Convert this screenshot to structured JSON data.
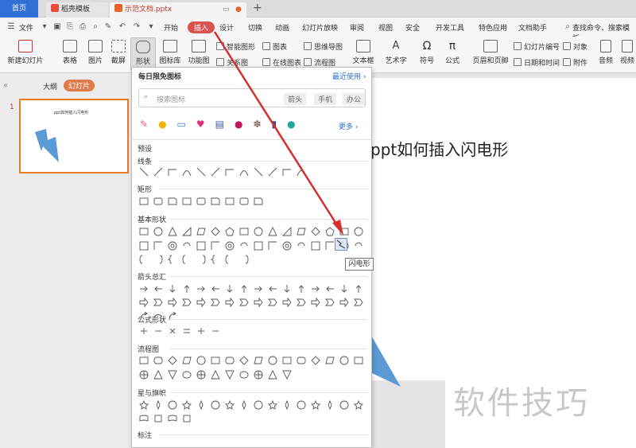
{
  "tabs": [
    {
      "label": "首页"
    },
    {
      "label": "稻壳模板"
    },
    {
      "label": "示范文档.pptx"
    }
  ],
  "menu": {
    "file": "文件",
    "items": [
      "开始",
      "插入",
      "设计",
      "切换",
      "动画",
      "幻灯片放映",
      "审阅",
      "视图",
      "安全",
      "开发工具",
      "特色应用",
      "文档助手"
    ],
    "active": "插入",
    "search": "查找命令、搜索模板"
  },
  "ribbon": {
    "new_slide": "新建幻灯片",
    "table": "表格",
    "picture": "图片",
    "screenshot": "截屏",
    "shape": "形状",
    "icon_library": "图标库",
    "function_chart": "功能图",
    "smart_graphic": "智能图形",
    "chart": "图表",
    "mind_map": "思维导图",
    "relation": "关系图",
    "online_chart": "在线图表",
    "flowchart": "流程图",
    "textbox": "文本框",
    "art_text": "艺术字",
    "symbol": "符号",
    "formula": "公式",
    "header_footer": "页眉和页脚",
    "slide_number": "幻灯片编号",
    "datetime": "日期和时间",
    "object": "对象",
    "attachment": "附件",
    "audio": "音频",
    "video": "视频"
  },
  "left_panel": {
    "outline_tab": "大纲",
    "slides_tab": "幻灯片",
    "slide_number": "1",
    "thumb_title": "ppt如何插入闪电形"
  },
  "slide": {
    "title": "ppt如何插入闪电形"
  },
  "dropdown": {
    "header": "每日限免图标",
    "recent": "最近使用",
    "search_placeholder": "搜索图标",
    "tags": [
      "箭头",
      "手机",
      "办公"
    ],
    "more": "更多",
    "preset": "预设",
    "sections": [
      "线条",
      "矩形",
      "基本形状",
      "箭头总汇",
      "公式形状",
      "流程图",
      "星与旗帜",
      "标注"
    ]
  },
  "tooltip": "闪电形",
  "watermark": "软件技巧",
  "colors": {
    "accent_red": "#d9534f",
    "home_tab": "#2f6fd6",
    "lightning_blue": "#5b9bd5",
    "arrow_red": "#d62f2f",
    "slide_thumb_border": "#e67e22"
  }
}
